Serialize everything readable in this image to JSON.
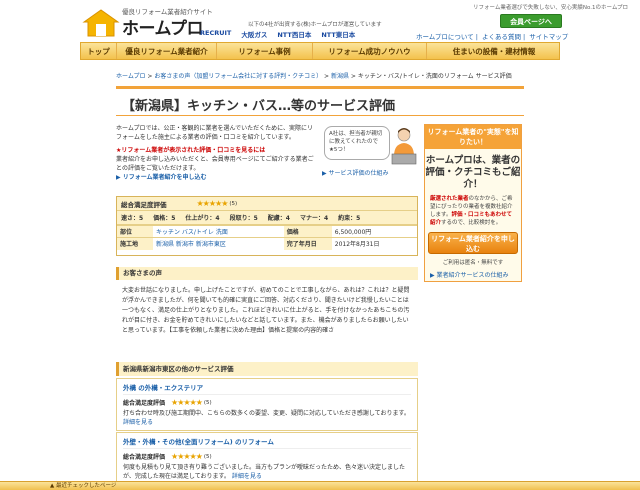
{
  "header": {
    "tagline": "優良リフォーム業者紹介サイト",
    "logo": "ホームプロ",
    "sponsor_text": "以下の4社が出資する(株)ホームプロが運営しています",
    "sponsors": [
      "RECRUIT",
      "大阪ガス",
      "NTT西日本",
      "NTT東日本"
    ],
    "top_right": "リフォーム業者選びで失敗しない、安心実績No.1のホームプロ",
    "member_button": "会員ページへ",
    "top_links": [
      "ホームプロについて",
      "よくある質問",
      "サイトマップ"
    ]
  },
  "nav": [
    {
      "label": "トップ",
      "w": 36
    },
    {
      "label": "優良リフォーム業者紹介",
      "w": 100
    },
    {
      "label": "リフォーム事例",
      "w": 96
    },
    {
      "label": "リフォーム成功ノウハウ",
      "w": 114
    },
    {
      "label": "住まいの設備・建材情報",
      "w": 134
    }
  ],
  "breadcrumb": {
    "items": [
      "ホームプロ",
      "お客さまの声（加盟リフォーム会社に対する評判・クチコミ）",
      "新潟県"
    ],
    "current": "キッチン・バス/トイレ・洗面のリフォーム サービス評価"
  },
  "page_title": "【新潟県】キッチン・バス…等のサービス評価",
  "intro": {
    "text": "ホームプロでは、公正・客観的に業者を選んでいただくために、実際にリフォームをした施主による業者の評価・口コミを紹介しています。",
    "red": "★リフォーム業者が表示された評価・口コミを見るには",
    "red_body": "業者紹介をお申し込みいただくと、会員専用ページにてご紹介する業者ごとの評価をご覧いただけます。",
    "link": "リフォーム業者紹介を申し込む"
  },
  "bubble": "A社は、担当者が親切に教えてくれたので★5つ！",
  "sample_link": "サービス評価の仕組み",
  "side_box": {
    "head": "リフォーム業者の\"実態\"を知りたい！",
    "big": "ホームプロは、業者の評価・クチコミもご紹介！",
    "text_red": "厳選された業者",
    "text_body": "のなかから、ご希望にぴったりの業者を複数社紹介します。",
    "text_red2": "評価・口コミもあわせて紹介",
    "text_body2": "するので、比較検討を。",
    "cta": "リフォーム業者紹介を申し込む",
    "free": "ご利用は匿名・無料です",
    "service_link": "業者紹介サービスの仕組み"
  },
  "rating": {
    "overall_label": "総合満足度評価",
    "overall_score": "(5)",
    "overall_stars": 5,
    "subs": [
      "速さ：5",
      "価格：5",
      "仕上がり：4",
      "段取り：5",
      "配慮：4",
      "マナー：4",
      "約束：5"
    ],
    "rows": [
      {
        "l1": "部位",
        "v1": "キッチン バス/トイレ 洗面",
        "l2": "価格",
        "v2": "6,500,000円"
      },
      {
        "l1": "施工地",
        "v1": "新潟県 新潟市 新潟市東区",
        "l2": "完了年月日",
        "v2": "2012年8月31日"
      }
    ]
  },
  "voice": {
    "head": "お客さまの声",
    "body": "大変お世話になりました。申し上げたことですが、初めてのことで工事しながら、あれは？これは？と疑問が浮かんできましたが、何を聞いても的確に実直にご回答、対応くださり、聞きたいけど我慢したいことは一つもなく、満足の仕上がりとなりました。これほどきれいに仕上がると、手を付けなかったあちこちの汚れが目に付き、お金を貯めてきれいにしたいなどと話しています。また、機会がありましたらお願いしたいと思っています。【工事を依頼した業者に決めた理由】価格と提案の内容的確さ"
  },
  "other": {
    "head": "新潟県新潟市東区の他のサービス評価",
    "cards": [
      {
        "title": "外構 の外構・エクステリア",
        "rate_label": "総合満足度評価",
        "score": "(5)",
        "stars": 5,
        "text": "打ち合わせ時及び施工期間中、こちらの数多くの要望、変更、疑問に対応していただき感謝しております。",
        "more": "詳細を見る"
      },
      {
        "title": "外壁・外構・その他(全面リフォーム) のリフォーム",
        "rate_label": "総合満足度評価",
        "score": "(5)",
        "stars": 5,
        "text": "何度も見積もり見て頂き有り難うございました。当方もプランが曖昧だったため、色々迷い決定しましたが、完成した現在は満足しております。",
        "more": "詳細を見る"
      }
    ]
  },
  "bottom_bar": "最近チェックしたページ"
}
